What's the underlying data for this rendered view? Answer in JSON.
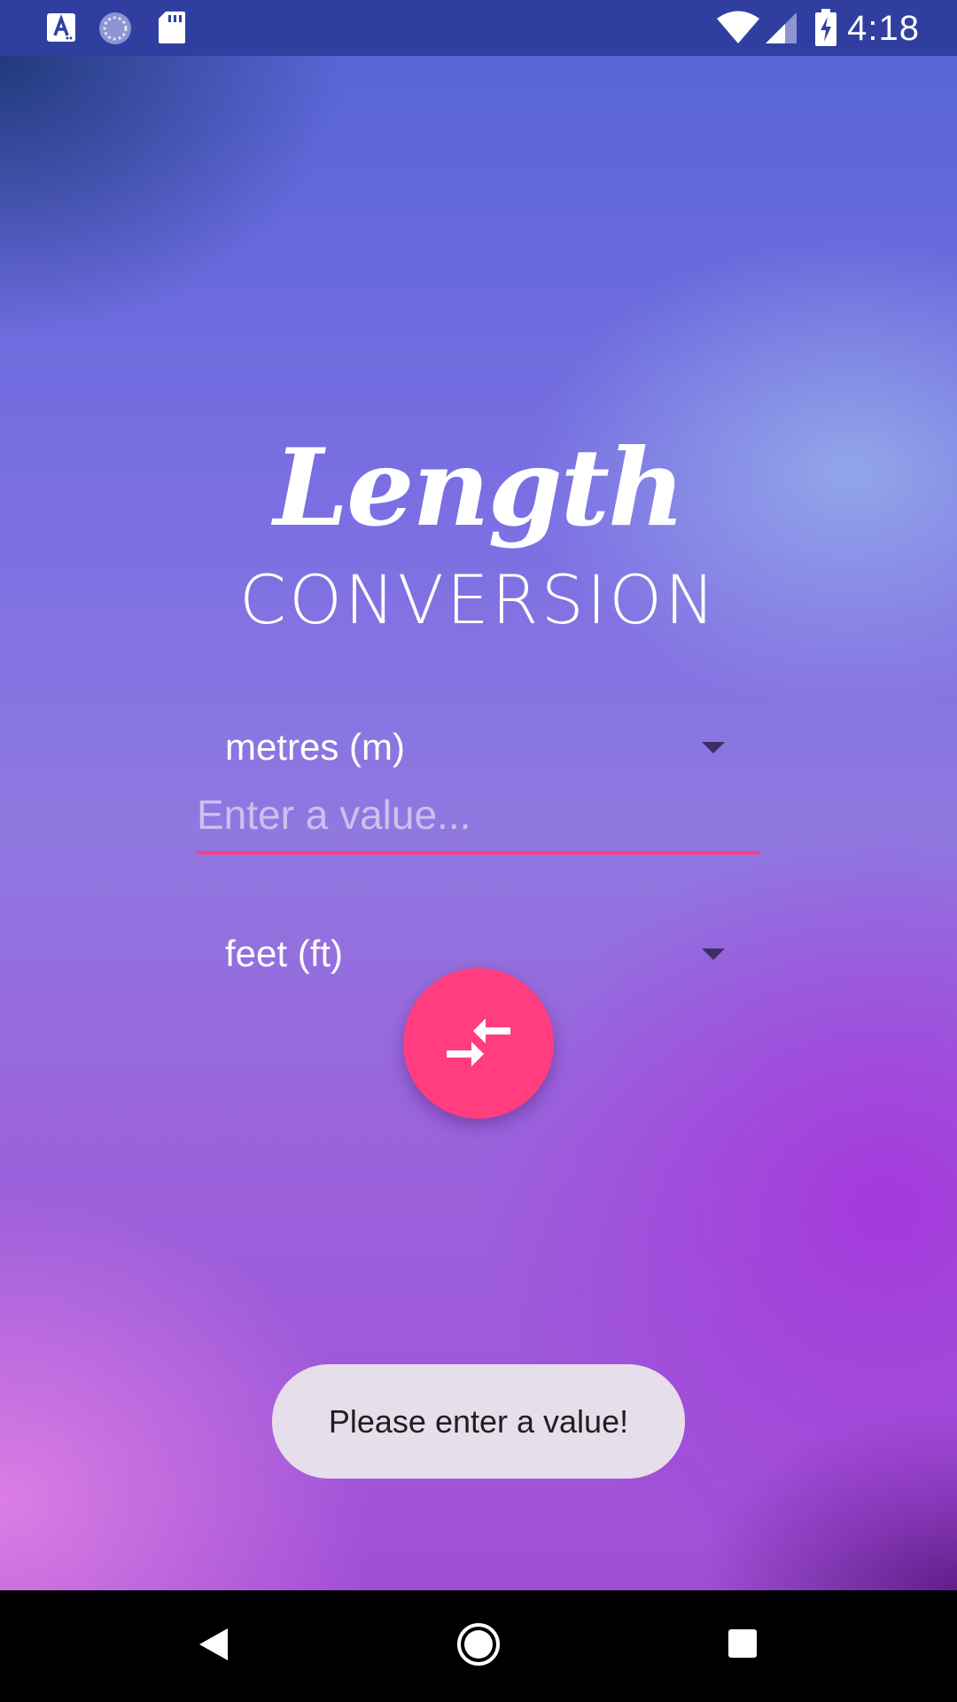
{
  "status_bar": {
    "time": "4:18",
    "left_icons": [
      "text-a-icon",
      "sync-circle-icon",
      "sd-card-icon"
    ],
    "right_icons": [
      "wifi-icon",
      "signal-icon",
      "battery-charging-icon"
    ]
  },
  "app": {
    "title_script": "Length",
    "title_sub": "CONVERSION",
    "from_unit": "metres (m)",
    "value_placeholder": "Enter a value...",
    "value": "",
    "to_unit": "feet (ft)",
    "convert_icon": "compare-arrows-icon",
    "toast": "Please enter a value!"
  },
  "colors": {
    "status_bar": "#303f9f",
    "accent": "#ff3d7f",
    "toast_bg": "#e6deea"
  },
  "nav_bar": {
    "buttons": [
      "back-icon",
      "home-icon",
      "recents-icon"
    ]
  }
}
